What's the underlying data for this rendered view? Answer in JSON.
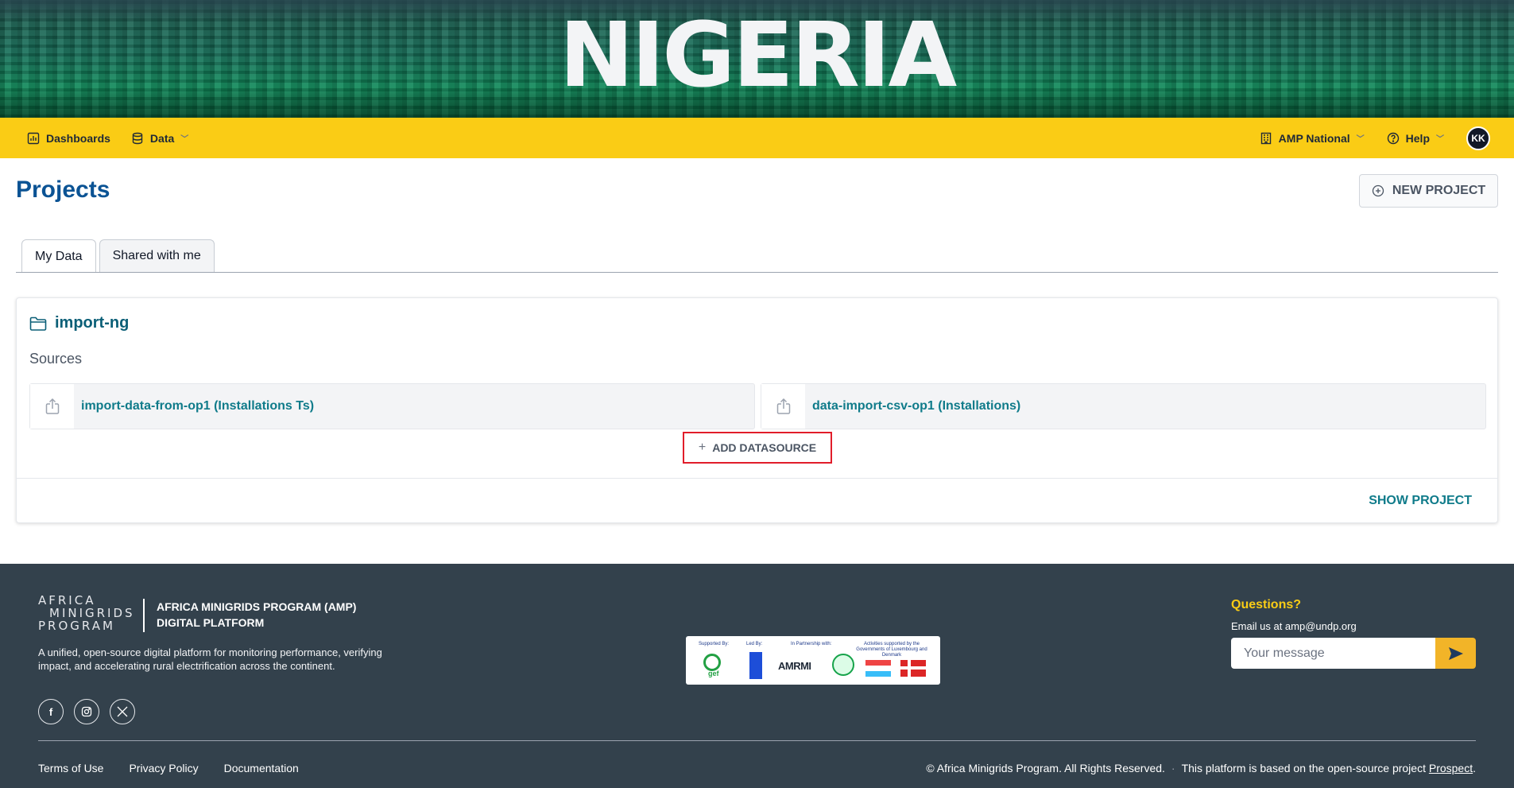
{
  "banner": {
    "title": "NIGERIA"
  },
  "nav": {
    "left": [
      {
        "label": "Dashboards",
        "icon": "chart-icon"
      },
      {
        "label": "Data",
        "icon": "database-icon"
      }
    ],
    "org_label": "AMP National",
    "help_label": "Help",
    "avatar_initials": "KK",
    "accent": "#facc15"
  },
  "page": {
    "title": "Projects",
    "new_project_label": "NEW PROJECT",
    "tabs": [
      {
        "label": "My Data",
        "active": true
      },
      {
        "label": "Shared with me",
        "active": false
      }
    ]
  },
  "project": {
    "name": "import-ng",
    "sources_label": "Sources",
    "sources": [
      {
        "label": "import-data-from-op1 (Installations Ts)"
      },
      {
        "label": "data-import-csv-op1 (Installations)"
      }
    ],
    "add_datasource_label": "ADD DATASOURCE",
    "show_project_label": "SHOW PROJECT"
  },
  "footer": {
    "logo_line1": "AFRICA",
    "logo_line2": "MINIGRIDS",
    "logo_line3": "PROGRAM",
    "title_line1": "AFRICA MINIGRIDS PROGRAM (AMP)",
    "title_line2": "DIGITAL PLATFORM",
    "description": "A unified, open-source digital platform for monitoring performance, verifying impact, and accelerating rural electrification across the continent.",
    "partners": {
      "supported_by": "Supported By:",
      "led_by": "Led By:",
      "partnership": "In Partnership with:",
      "activities": "Activities supported by the Governments of Luxembourg and Denmark",
      "gef": "gef",
      "amrmi": "AMRMI"
    },
    "questions_title": "Questions?",
    "email_line": "Email us at amp@undp.org",
    "message_placeholder": "Your message",
    "links": [
      "Terms of Use",
      "Privacy Policy",
      "Documentation"
    ],
    "copyright": "© Africa Minigrids Program. All Rights Reserved.",
    "dot": "·",
    "based_on": "This platform is based on the open-source project",
    "prospect_link": "Prospect",
    "period": "."
  }
}
